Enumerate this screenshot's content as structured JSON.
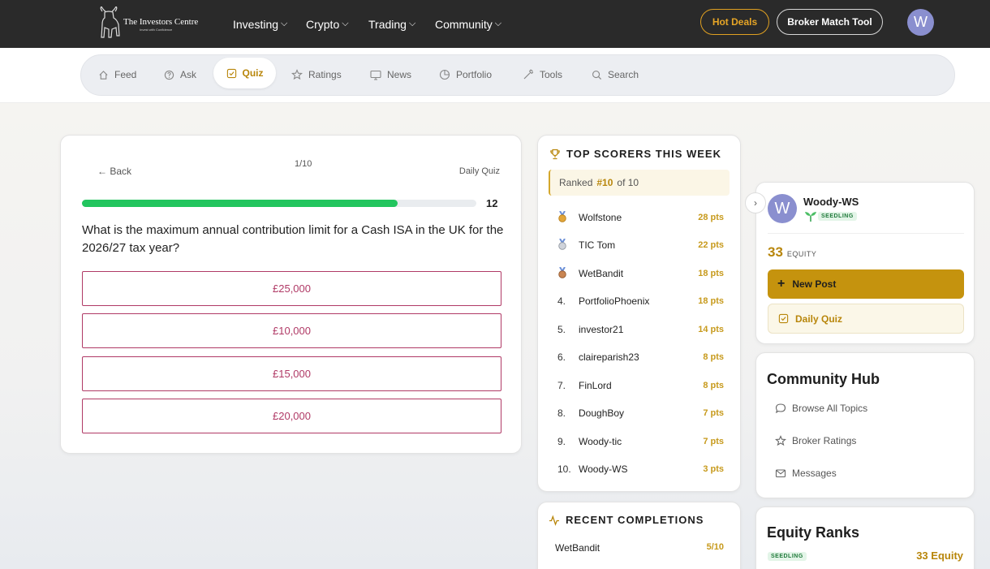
{
  "brand": {
    "name": "The Investors Centre",
    "tagline": "Invest with Confidence"
  },
  "topnav": {
    "items": [
      {
        "label": "Investing"
      },
      {
        "label": "Crypto"
      },
      {
        "label": "Trading"
      },
      {
        "label": "Community"
      }
    ]
  },
  "actions": {
    "hot_deals": "Hot Deals",
    "broker_match": "Broker Match Tool",
    "avatar_initial": "W"
  },
  "subnav": {
    "items": [
      {
        "label": "Feed",
        "icon": "home-icon"
      },
      {
        "label": "Ask",
        "icon": "question-icon"
      },
      {
        "label": "Quiz",
        "icon": "checkbox-icon",
        "active": true
      },
      {
        "label": "Ratings",
        "icon": "star-icon"
      },
      {
        "label": "News",
        "icon": "monitor-icon"
      },
      {
        "label": "Portfolio",
        "icon": "pie-chart-icon"
      },
      {
        "label": "Tools",
        "icon": "wrench-icon"
      },
      {
        "label": "Search",
        "icon": "search-icon"
      }
    ]
  },
  "quiz": {
    "back_label": "← Back",
    "counter": "1/10",
    "type_label": "Daily Quiz",
    "progress": 0.8,
    "timer": "12",
    "question": "What is the maximum annual contribution limit for a Cash ISA in the UK for the 2026/27 tax year?",
    "answers": [
      "£25,000",
      "£10,000",
      "£15,000",
      "£20,000"
    ]
  },
  "scorers": {
    "title": "TOP SCORERS THIS WEEK",
    "ranked_prefix": "Ranked",
    "ranked_value": "#10",
    "ranked_suffix": "of 10",
    "rows": [
      {
        "rank": "",
        "medal": "gold-medal-icon",
        "name": "Wolfstone",
        "pts": "28 pts"
      },
      {
        "rank": "",
        "medal": "silver-medal-icon",
        "name": "TIC Tom",
        "pts": "22 pts"
      },
      {
        "rank": "",
        "medal": "bronze-medal-icon",
        "name": "WetBandit",
        "pts": "18 pts"
      },
      {
        "rank": "4.",
        "name": "PortfolioPhoenix",
        "pts": "18 pts"
      },
      {
        "rank": "5.",
        "name": "investor21",
        "pts": "14 pts"
      },
      {
        "rank": "6.",
        "name": "claireparish23",
        "pts": "8 pts"
      },
      {
        "rank": "7.",
        "name": "FinLord",
        "pts": "8 pts"
      },
      {
        "rank": "8.",
        "name": "DoughBoy",
        "pts": "7 pts"
      },
      {
        "rank": "9.",
        "name": "Woody-tic",
        "pts": "7 pts"
      },
      {
        "rank": "10.",
        "name": "Woody-WS",
        "pts": "3 pts"
      }
    ]
  },
  "completions": {
    "title": "RECENT COMPLETIONS",
    "rows": [
      {
        "name": "WetBandit",
        "score": "5/10"
      }
    ]
  },
  "profile": {
    "collapse_icon": "chevron-right-icon",
    "initial": "W",
    "name": "Woody-WS",
    "tier": "SEEDLING",
    "equity_value": "33",
    "equity_label": "EQUITY",
    "new_post": "New Post",
    "daily_quiz": "Daily Quiz"
  },
  "hub": {
    "title": "Community Hub",
    "items": [
      "Browse All Topics",
      "Broker Ratings",
      "Messages"
    ]
  },
  "ranks": {
    "title": "Equity Ranks",
    "tier": "SEEDLING",
    "equity": "33 Equity"
  },
  "colors": {
    "accent": "#b8860b",
    "progress": "#22c55e",
    "answer": "#b03a66",
    "topbar": "#2a2a2a"
  }
}
